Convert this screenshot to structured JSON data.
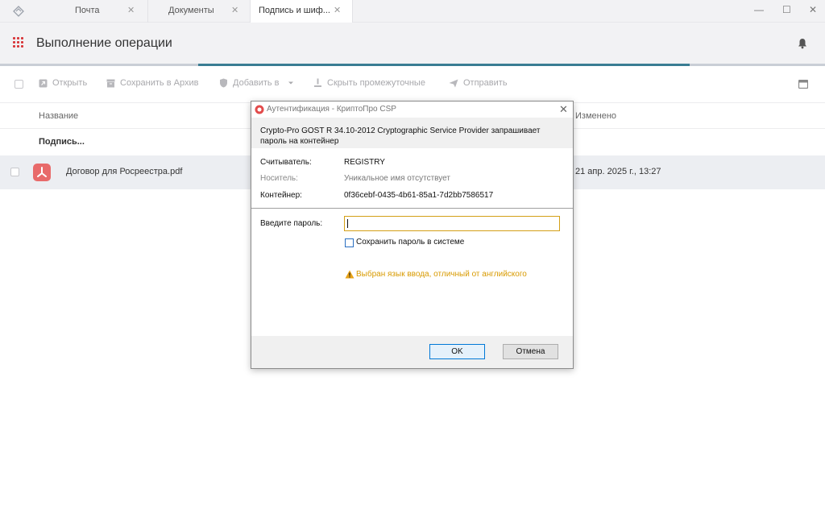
{
  "tabs": [
    {
      "label": "Почта",
      "active": false
    },
    {
      "label": "Документы",
      "active": false
    },
    {
      "label": "Подпись и шиф...",
      "active": true
    }
  ],
  "window_controls": {
    "minimize": "—",
    "maximize": "☐",
    "close": "✕"
  },
  "header": {
    "title": "Выполнение операции"
  },
  "progress": {
    "percent": 60
  },
  "toolbar": {
    "open": "Открыть",
    "save_archive": "Сохранить в Архив",
    "add_to": "Добавить в",
    "hide_intermediate": "Скрыть промежуточные",
    "send": "Отправить"
  },
  "table": {
    "col_name": "Название",
    "col_modified": "Изменено",
    "group_label": "Подпись...",
    "rows": [
      {
        "name": "Договор для Росреестра.pdf",
        "modified": "21 апр. 2025 г., 13:27"
      }
    ]
  },
  "dialog": {
    "title": "Аутентификация - КриптоПро CSP",
    "message": "Crypto-Pro GOST R 34.10-2012 Cryptographic Service Provider запрашивает пароль на контейнер",
    "reader_label": "Считыватель:",
    "reader_value": "REGISTRY",
    "media_label": "Носитель:",
    "media_value": "Уникальное имя отсутствует",
    "container_label": "Контейнер:",
    "container_value": "0f36cebf-0435-4b61-85a1-7d2bb7586517",
    "password_label": "Введите пароль:",
    "password_value": "",
    "save_password_label": "Сохранить пароль в системе",
    "warning_text": "Выбран язык ввода, отличный от английского",
    "ok_label": "OK",
    "cancel_label": "Отмена"
  },
  "colors": {
    "accent": "#3a7d93",
    "pdf_badge": "#e86a6a",
    "warning": "#d89a00",
    "grid_icon": "#d8373a"
  }
}
